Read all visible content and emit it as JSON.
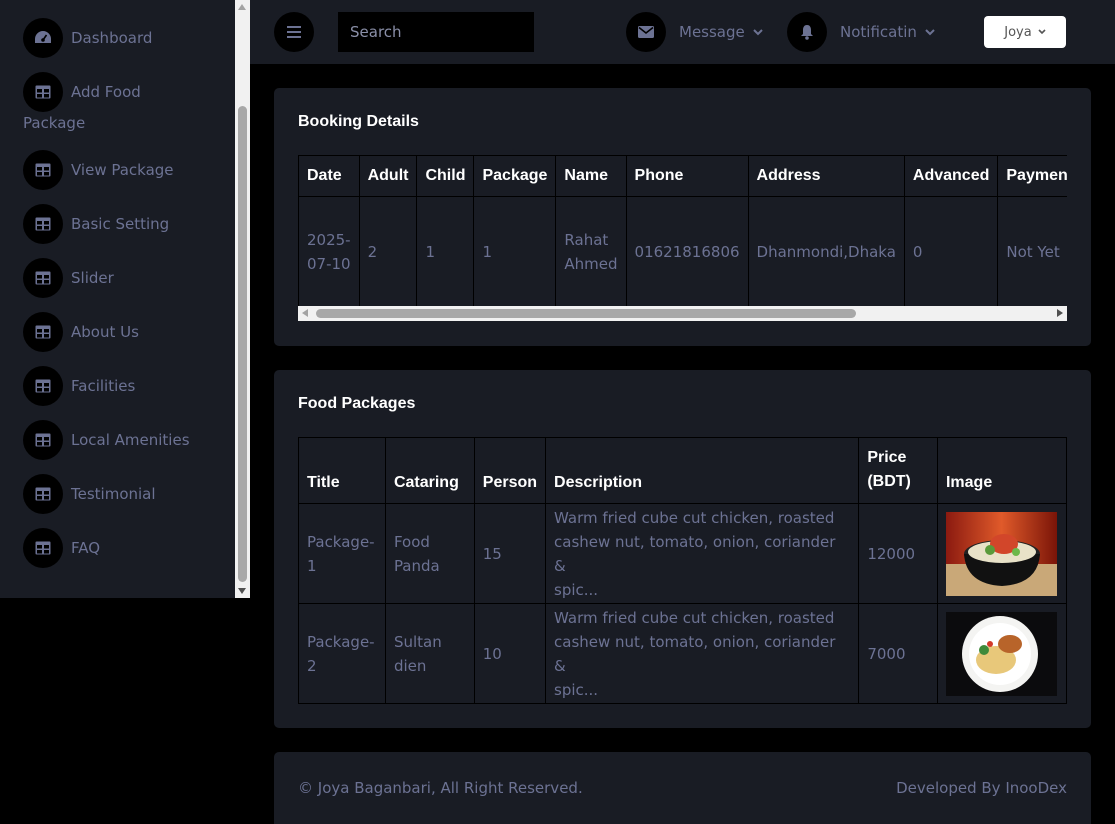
{
  "colors": {
    "page_bg": "#000000",
    "panel_bg": "#191c24",
    "text_muted": "#6c7293",
    "text_heading": "#ffffff"
  },
  "sidebar": {
    "items": [
      {
        "label": "Dashboard",
        "icon": "dashboard-gauge-icon"
      },
      {
        "label_line1": "Add Food",
        "label_line2": "Package",
        "icon": "table-icon"
      },
      {
        "label": "View Package",
        "icon": "table-icon"
      },
      {
        "label": "Basic Setting",
        "icon": "table-icon"
      },
      {
        "label": "Slider",
        "icon": "table-icon"
      },
      {
        "label": "About Us",
        "icon": "table-icon"
      },
      {
        "label": "Facilities",
        "icon": "table-icon"
      },
      {
        "label": "Local Amenities",
        "icon": "table-icon"
      },
      {
        "label": "Testimonial",
        "icon": "table-icon"
      },
      {
        "label": "FAQ",
        "icon": "table-icon"
      }
    ]
  },
  "topbar": {
    "search_placeholder": "Search",
    "message_label": "Message",
    "notification_label": "Notificatin",
    "user_label": "Joya"
  },
  "booking": {
    "title": "Booking Details",
    "headers": [
      "Date",
      "Adult",
      "Child",
      "Package",
      "Name",
      "Phone",
      "Address",
      "Advanced",
      "PaymentBy"
    ],
    "rows": [
      {
        "date_line1": "2025-",
        "date_line2": "07-10",
        "adult": "2",
        "child": "1",
        "package": "1",
        "name_line1": "Rahat",
        "name_line2": "Ahmed",
        "phone": "01621816806",
        "address": "Dhanmondi,Dhaka",
        "advanced": "0",
        "payment_by": "Not Yet"
      }
    ]
  },
  "food": {
    "title": "Food Packages",
    "headers": {
      "title": "Title",
      "catering": "Cataring",
      "person": "Person",
      "description": "Description",
      "price_line1": "Price",
      "price_line2": "(BDT)",
      "image": "Image"
    },
    "rows": [
      {
        "title_line1": "Package-",
        "title_line2": "1",
        "catering_line1": "Food",
        "catering_line2": "Panda",
        "person": "15",
        "desc_line1": "Warm fried cube cut chicken, roasted",
        "desc_line2": "cashew nut, tomato, onion, coriander &",
        "desc_line3": "spic...",
        "price": "12000"
      },
      {
        "title_line1": "Package-",
        "title_line2": "2",
        "catering_line1": "Sultan",
        "catering_line2": "dien",
        "person": "10",
        "desc_line1": "Warm fried cube cut chicken, roasted",
        "desc_line2": "cashew nut, tomato, onion, coriander &",
        "desc_line3": "spic...",
        "price": "7000"
      }
    ]
  },
  "footer": {
    "copyright": "© Joya Baganbari, All Right Reserved.",
    "developer": "Developed By InooDex"
  }
}
